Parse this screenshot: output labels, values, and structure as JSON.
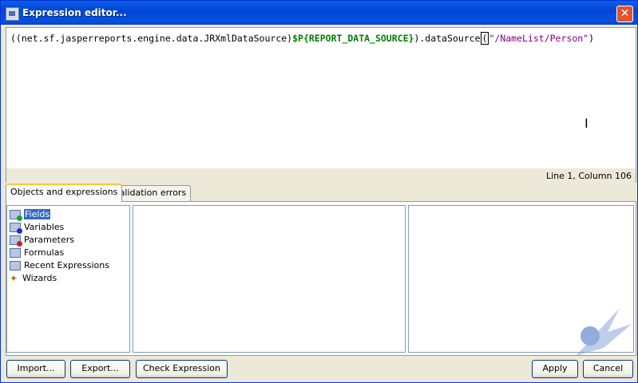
{
  "window": {
    "title": "Expression editor...",
    "close_glyph": "✕"
  },
  "editor": {
    "code_prefix": "((net.sf.jasperreports.engine.data.JRXmlDataSource)",
    "code_var": "$P{REPORT_DATA_SOURCE}",
    "code_mid": ").dataSource",
    "code_paren": "(",
    "code_string": "\"/NameList/Person\"",
    "code_suffix": ")",
    "cursor_glyph": "I"
  },
  "status": {
    "position_text": "Line 1, Column 106"
  },
  "tabs": [
    {
      "label": "Objects and expressions",
      "active": true
    },
    {
      "label": "Validation errors",
      "active": false
    }
  ],
  "tree": {
    "items": [
      {
        "label": "Fields",
        "icon": "folder-green-icon",
        "selected": true
      },
      {
        "label": "Variables",
        "icon": "folder-blue-icon",
        "selected": false
      },
      {
        "label": "Parameters",
        "icon": "folder-red-icon",
        "selected": false
      },
      {
        "label": "Formulas",
        "icon": "folder-icon",
        "selected": false
      },
      {
        "label": "Recent Expressions",
        "icon": "folder-icon",
        "selected": false
      },
      {
        "label": "Wizards",
        "icon": "wand-icon",
        "selected": false
      }
    ]
  },
  "buttons": {
    "import": "Import...",
    "export": "Export...",
    "check": "Check Expression",
    "apply": "Apply",
    "cancel": "Cancel"
  },
  "colors": {
    "title_bar": "#0551e0",
    "variable_green": "#007f00",
    "string_purple": "#800080",
    "selection_blue": "#316ac5"
  }
}
